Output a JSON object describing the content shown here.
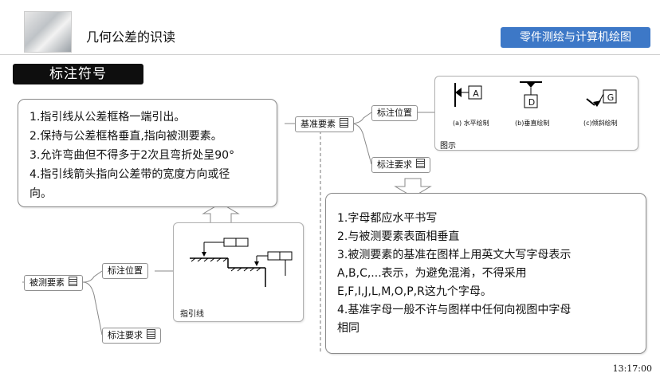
{
  "header": {
    "title": "几何公差的识读",
    "course_button": "零件测绘与计算机绘图"
  },
  "section_label": "标注符号",
  "left_bubble": {
    "lines": [
      "1.指引线从公差框格一端引出。",
      "2.保持与公差框格垂直,指向被测要素。",
      "3.允许弯曲但不得多于2次且弯折处呈90°",
      "4.指引线箭头指向公差带的宽度方向或径",
      "向。"
    ]
  },
  "right_bubble": {
    "lines": [
      "1.字母都应水平书写",
      "2.与被测要素表面相垂直",
      "3.被测要素的基准在图样上用英文大写字母表示",
      "A,B,C,...表示，为避免混淆，不得采用",
      "E,F,I,J,L,M,O,P,R这九个字母。",
      "4.基准字母一般不许与图样中任何向视图中字母",
      "相同"
    ]
  },
  "mindmap_top": {
    "root": "基准要素",
    "branches": [
      "标注位置",
      "标注要求"
    ],
    "figure": {
      "letters": [
        "A",
        "D",
        "G"
      ],
      "captions": [
        "(a) 水平绘制",
        "(b)垂直绘制",
        "(c)倾斜绘制"
      ],
      "label": "图示"
    }
  },
  "mindmap_bottom": {
    "root": "被测要素",
    "branches": [
      "标注位置",
      "标注要求"
    ],
    "figure": {
      "label": "指引线"
    }
  },
  "timestamp": "13:17:00",
  "colors": {
    "accent": "#3d78c7",
    "section_bg": "#0e0e0e",
    "border": "#8c8c8c"
  }
}
